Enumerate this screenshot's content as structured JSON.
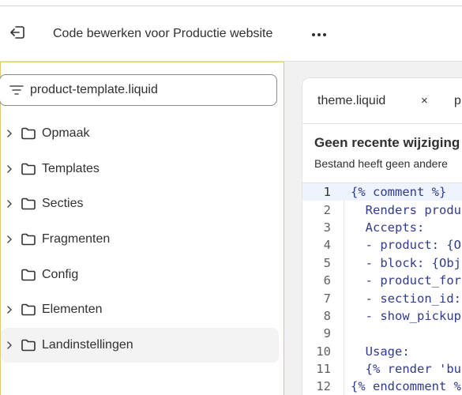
{
  "header": {
    "title": "Code bewerken voor Productie website",
    "exit_icon": "exit-icon",
    "more_icon": "more-horizontal-icon"
  },
  "search": {
    "value": "product-template.liquid",
    "filter_icon": "filter-icon"
  },
  "tree": {
    "items": [
      {
        "label": "Opmaak",
        "expandable": true
      },
      {
        "label": "Templates",
        "expandable": true
      },
      {
        "label": "Secties",
        "expandable": true
      },
      {
        "label": "Fragmenten",
        "expandable": true
      },
      {
        "label": "Config",
        "expandable": false
      },
      {
        "label": "Elementen",
        "expandable": true
      },
      {
        "label": "Landinstellingen",
        "expandable": true
      }
    ]
  },
  "editor": {
    "tabs": [
      {
        "label": "theme.liquid",
        "close": "×"
      },
      {
        "label": "p"
      }
    ],
    "notice_title": "Geen recente wijziging",
    "notice_sub": "Bestand heeft geen andere",
    "lines": [
      {
        "n": "1",
        "text": "{% comment %}"
      },
      {
        "n": "2",
        "text": "  Renders produ"
      },
      {
        "n": "3",
        "text": "  Accepts:"
      },
      {
        "n": "4",
        "text": "  - product: {O"
      },
      {
        "n": "5",
        "text": "  - block: {Obj"
      },
      {
        "n": "6",
        "text": "  - product_for"
      },
      {
        "n": "7",
        "text": "  - section_id:"
      },
      {
        "n": "8",
        "text": "  - show_pickup"
      },
      {
        "n": "9",
        "text": ""
      },
      {
        "n": "10",
        "text": "  Usage:"
      },
      {
        "n": "11",
        "text": "  {% render 'bu"
      },
      {
        "n": "12",
        "text": "{% endcomment %"
      }
    ]
  },
  "colors": {
    "code_text": "#303a8f",
    "active_line": "#eef3fd",
    "panel_border": "#e0c97a"
  }
}
